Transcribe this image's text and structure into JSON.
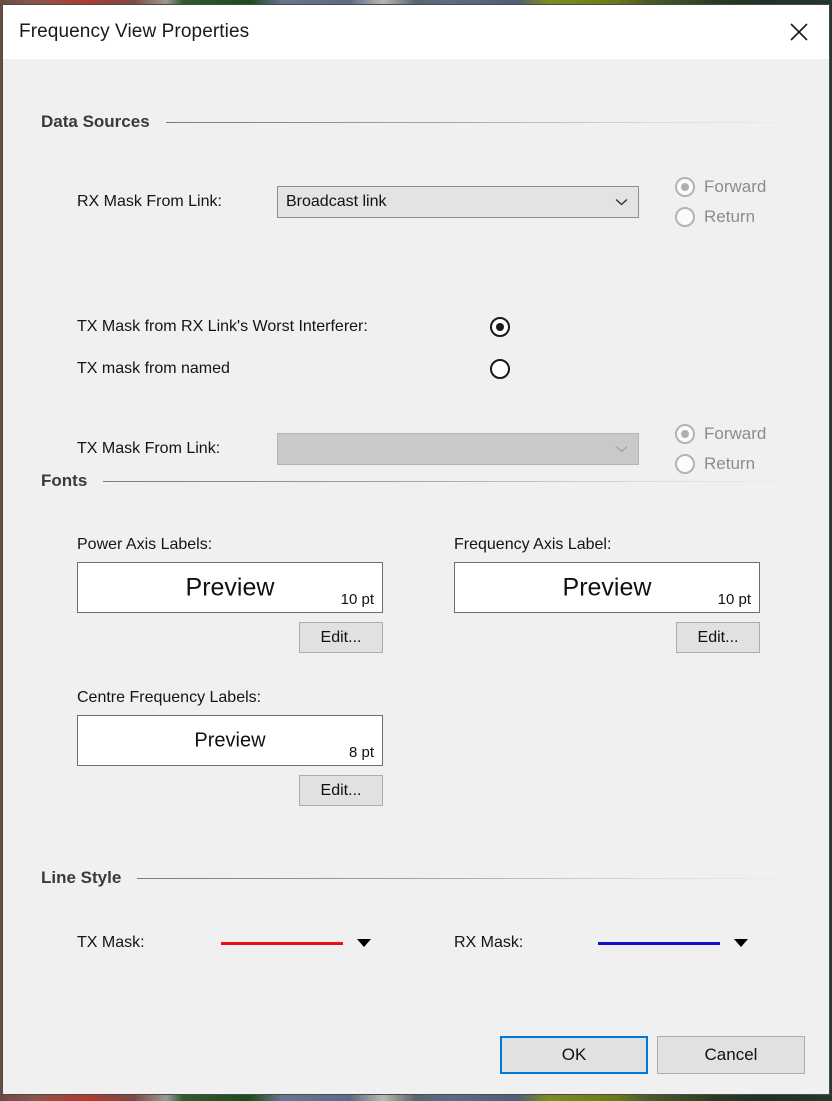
{
  "window": {
    "title": "Frequency View Properties",
    "close_icon": "close-icon"
  },
  "sections": {
    "data_sources": {
      "title": "Data Sources",
      "rx_mask_label": "RX Mask From Link:",
      "rx_mask_value": "Broadcast link",
      "rx_direction": {
        "forward_label": "Forward",
        "return_label": "Return",
        "selected": "Forward",
        "enabled": false
      },
      "tx_worst_interferer_label": "TX Mask from RX Link's Worst Interferer:",
      "tx_named_label": "TX mask from named",
      "tx_source_selected": "worst_interferer",
      "tx_mask_label": "TX Mask From Link:",
      "tx_mask_value": "",
      "tx_mask_enabled": false,
      "tx_direction": {
        "forward_label": "Forward",
        "return_label": "Return",
        "selected": "Forward",
        "enabled": false
      }
    },
    "fonts": {
      "title": "Fonts",
      "items": [
        {
          "caption": "Power Axis Labels:",
          "preview_text": "Preview",
          "size_label": "10 pt",
          "preview_px": "25",
          "edit_label": "Edit..."
        },
        {
          "caption": "Frequency Axis Label:",
          "preview_text": "Preview",
          "size_label": "10 pt",
          "preview_px": "25",
          "edit_label": "Edit..."
        },
        {
          "caption": "Centre Frequency Labels:",
          "preview_text": "Preview",
          "size_label": "8 pt",
          "preview_px": "20",
          "edit_label": "Edit..."
        }
      ]
    },
    "line_style": {
      "title": "Line Style",
      "items": [
        {
          "label": "TX Mask:",
          "color": "#ee1111"
        },
        {
          "label": "RX Mask:",
          "color": "#1111cc"
        }
      ]
    }
  },
  "footer": {
    "ok_label": "OK",
    "cancel_label": "Cancel"
  }
}
